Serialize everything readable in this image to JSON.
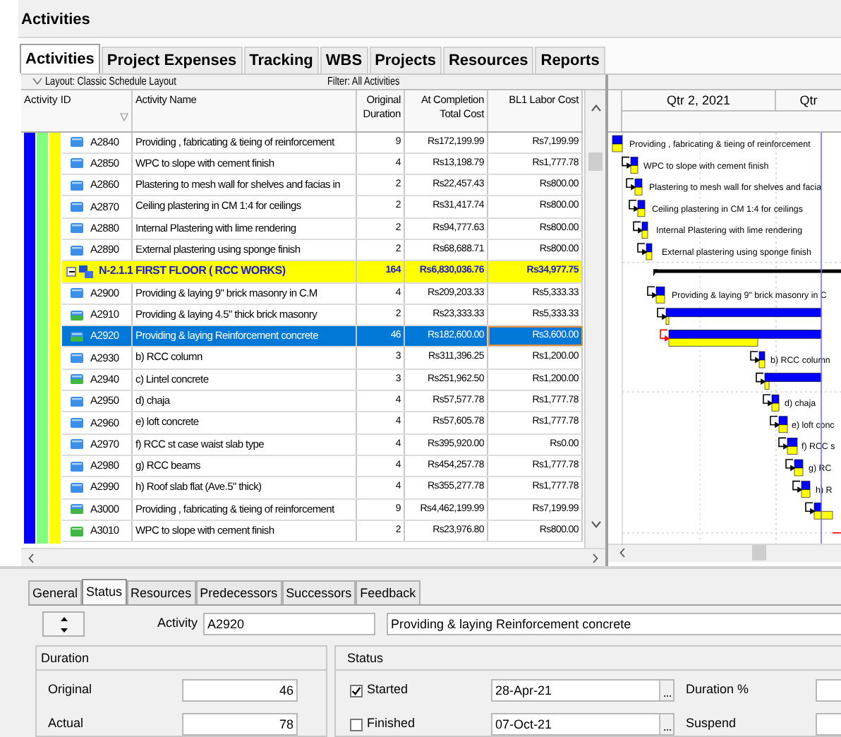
{
  "panel_title": "Activities",
  "tabs": [
    {
      "label": "Activities",
      "selected": true
    },
    {
      "label": "Project Expenses",
      "selected": false
    },
    {
      "label": "Tracking",
      "selected": false
    },
    {
      "label": "WBS",
      "selected": false
    },
    {
      "label": "Projects",
      "selected": false
    },
    {
      "label": "Resources",
      "selected": false
    },
    {
      "label": "Reports",
      "selected": false
    }
  ],
  "layout_bar": {
    "layout": "Layout: Classic Schedule Layout",
    "filter": "Filter: All Activities"
  },
  "table": {
    "columns": [
      "Activity ID",
      "Activity Name",
      "Original\nDuration",
      "At Completion\nTotal Cost",
      "BL1 Labor Cost"
    ],
    "rows": [
      {
        "kind": "activity",
        "id": "A2840",
        "name": "Providing , fabricating & tieing of reinforcement",
        "duration": "9",
        "total_cost": "Rs172,199.99",
        "bl1_labor_cost": "Rs7,199.99",
        "started": false,
        "finished": false,
        "selected": false,
        "bar_label": "Providing , fabricating & tieing of reinforcement"
      },
      {
        "kind": "activity",
        "id": "A2850",
        "name": "WPC to slope with cement finish",
        "duration": "4",
        "total_cost": "Rs13,198.79",
        "bl1_labor_cost": "Rs1,777.78",
        "started": false,
        "finished": false,
        "selected": false,
        "bar_label": "WPC to slope with cement finish"
      },
      {
        "kind": "activity",
        "id": "A2860",
        "name": "Plastering to mesh wall for shelves and facias in",
        "duration": "2",
        "total_cost": "Rs22,457.43",
        "bl1_labor_cost": "Rs800.00",
        "started": false,
        "finished": false,
        "selected": false,
        "bar_label": "Plastering to mesh wall for shelves and facia"
      },
      {
        "kind": "activity",
        "id": "A2870",
        "name": "Ceiling plastering in CM 1:4 for ceilings",
        "duration": "2",
        "total_cost": "Rs31,417.74",
        "bl1_labor_cost": "Rs800.00",
        "started": false,
        "finished": false,
        "selected": false,
        "bar_label": "Ceiling plastering in CM 1:4 for ceilings"
      },
      {
        "kind": "activity",
        "id": "A2880",
        "name": "Internal Plastering with lime rendering",
        "duration": "2",
        "total_cost": "Rs94,777.63",
        "bl1_labor_cost": "Rs800.00",
        "started": false,
        "finished": false,
        "selected": false,
        "bar_label": "Internal Plastering with lime rendering"
      },
      {
        "kind": "activity",
        "id": "A2890",
        "name": "External plastering using sponge finish",
        "duration": "2",
        "total_cost": "Rs68,688.71",
        "bl1_labor_cost": "Rs800.00",
        "started": false,
        "finished": false,
        "selected": false,
        "bar_label": "External plastering using sponge finish"
      },
      {
        "kind": "wbs",
        "id": "N-2.1.1  FIRST FLOOR ( RCC WORKS)",
        "expanded": true,
        "duration": "164",
        "total_cost": "Rs6,830,036.76",
        "bl1_labor_cost": "Rs34,977.75",
        "selected": false
      },
      {
        "kind": "activity",
        "id": "A2900",
        "name": "Providing & laying 9\" brick masonry in C.M",
        "duration": "4",
        "total_cost": "Rs209,203.33",
        "bl1_labor_cost": "Rs5,333.33",
        "started": false,
        "finished": false,
        "selected": false,
        "bar_label": "Providing & laying 9\" brick masonry in C"
      },
      {
        "kind": "activity",
        "id": "A2910",
        "name": "Providing & laying 4.5\" thick brick masonry",
        "duration": "2",
        "total_cost": "Rs23,333.33",
        "bl1_labor_cost": "Rs5,333.33",
        "started": true,
        "finished": false,
        "selected": false
      },
      {
        "kind": "activity",
        "id": "A2920",
        "name": "Providing & laying Reinforcement concrete",
        "duration": "46",
        "total_cost": "Rs182,600.00",
        "bl1_labor_cost": "Rs3,600.00",
        "started": true,
        "finished": false,
        "selected": true
      },
      {
        "kind": "activity",
        "id": "A2930",
        "name": "b) RCC column",
        "duration": "3",
        "total_cost": "Rs311,396.25",
        "bl1_labor_cost": "Rs1,200.00",
        "started": false,
        "finished": false,
        "selected": false,
        "bar_label": "b) RCC column"
      },
      {
        "kind": "activity",
        "id": "A2940",
        "name": "c) Lintel concrete",
        "duration": "3",
        "total_cost": "Rs251,962.50",
        "bl1_labor_cost": "Rs1,200.00",
        "started": true,
        "finished": false,
        "selected": false
      },
      {
        "kind": "activity",
        "id": "A2950",
        "name": "d) chaja",
        "duration": "4",
        "total_cost": "Rs57,577.78",
        "bl1_labor_cost": "Rs1,777.78",
        "started": false,
        "finished": false,
        "selected": false,
        "bar_label": "d) chaja"
      },
      {
        "kind": "activity",
        "id": "A2960",
        "name": "e) loft concrete",
        "duration": "4",
        "total_cost": "Rs57,605.78",
        "bl1_labor_cost": "Rs1,777.78",
        "started": false,
        "finished": false,
        "selected": false,
        "bar_label": "e) loft conc"
      },
      {
        "kind": "activity",
        "id": "A2970",
        "name": "f) RCC st case waist slab type",
        "duration": "4",
        "total_cost": "Rs395,920.00",
        "bl1_labor_cost": "Rs0.00",
        "started": false,
        "finished": false,
        "selected": false,
        "bar_label": "f) RCC s"
      },
      {
        "kind": "activity",
        "id": "A2980",
        "name": "g) RCC beams",
        "duration": "4",
        "total_cost": "Rs454,257.78",
        "bl1_labor_cost": "Rs1,777.78",
        "started": false,
        "finished": false,
        "selected": false,
        "bar_label": "g) RC"
      },
      {
        "kind": "activity",
        "id": "A2990",
        "name": "h) Roof slab flat (Ave.5\" thick)",
        "duration": "4",
        "total_cost": "Rs355,277.78",
        "bl1_labor_cost": "Rs1,777.78",
        "started": false,
        "finished": false,
        "selected": false,
        "bar_label": "h) R"
      },
      {
        "kind": "activity",
        "id": "A3000",
        "name": "Providing , fabricating & tieing of reinforcement",
        "duration": "9",
        "total_cost": "Rs4,462,199.99",
        "bl1_labor_cost": "Rs7,199.99",
        "started": true,
        "finished": false,
        "selected": false
      },
      {
        "kind": "activity",
        "id": "A3010",
        "name": "WPC to slope with cement finish",
        "duration": "2",
        "total_cost": "Rs23,976.80",
        "bl1_labor_cost": "Rs800.00",
        "started": true,
        "finished": true,
        "selected": false
      }
    ]
  },
  "gantt": {
    "timescale": [
      "Qtr 2, 2021",
      "Qtr"
    ]
  },
  "details": {
    "tabs": [
      {
        "label": "General",
        "selected": false
      },
      {
        "label": "Status",
        "selected": true
      },
      {
        "label": "Resources",
        "selected": false
      },
      {
        "label": "Predecessors",
        "selected": false
      },
      {
        "label": "Successors",
        "selected": false
      },
      {
        "label": "Feedback",
        "selected": false
      }
    ],
    "activity_label": "Activity",
    "activity_id": "A2920",
    "activity_name": "Providing & laying Reinforcement concrete",
    "duration": {
      "title": "Duration",
      "fields": [
        {
          "label": "Original",
          "value": "46"
        },
        {
          "label": "Actual",
          "value": "78"
        }
      ]
    },
    "status": {
      "title": "Status",
      "rows": [
        {
          "label": "Started",
          "checked": true,
          "date": "28-Apr-21",
          "side_label": "Duration %"
        },
        {
          "label": "Finished",
          "checked": false,
          "date": "07-Oct-21",
          "side_label": "Suspend"
        }
      ]
    }
  }
}
